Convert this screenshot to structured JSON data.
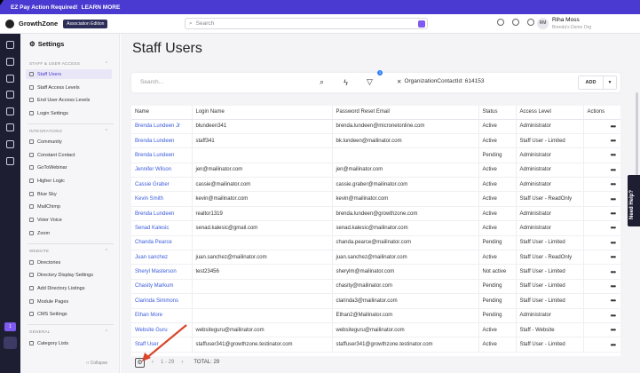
{
  "alert": {
    "text": "EZ Pay Action Required!",
    "link": "LEARN MORE"
  },
  "header": {
    "brand": "GrowthZone",
    "edition": "Association Edition",
    "search_placeholder": "Search",
    "user_initials": "RM",
    "user_name": "Riha Moss",
    "user_org": "Brenda's Demo Org"
  },
  "sidebar": {
    "title": "Settings",
    "sections": [
      {
        "label": "STAFF & USER ACCESS",
        "items": [
          "Staff Users",
          "Staff Access Levels",
          "End User Access Levels",
          "Login Settings"
        ]
      },
      {
        "label": "INTEGRATIONS",
        "items": [
          "Community",
          "Constant Contact",
          "GoToWebinar",
          "Higher Logic",
          "Blue Sky",
          "MailChimp",
          "Voter Voice",
          "Zoom"
        ]
      },
      {
        "label": "WEBSITE",
        "items": [
          "Directories",
          "Directory Display Settings",
          "Add Directory Listings",
          "Module Pages",
          "CMS Settings"
        ]
      },
      {
        "label": "GENERAL",
        "items": [
          "Category Lists"
        ]
      }
    ],
    "collapse_label": "Collapse",
    "notification_count": "1"
  },
  "main": {
    "title": "Staff Users",
    "search_placeholder": "Search...",
    "filter_chip": "OrganizationContactId: 614153",
    "filter_badge": "1",
    "add_label": "ADD",
    "columns": [
      "Name",
      "Login Name",
      "Password Reset Email",
      "Status",
      "Access Level",
      "Actions"
    ],
    "rows": [
      [
        "Brenda Lundeen Jr",
        "blundeen341",
        "brenda.lundeen@micronetonline.com",
        "Active",
        "Administrator"
      ],
      [
        "Brenda Lundeen",
        "staff341",
        "bk.lundeen@mailinator.com",
        "Active",
        "Staff User - Limited"
      ],
      [
        "Brenda Lundeen",
        "",
        "",
        "Pending",
        "Administrator"
      ],
      [
        "Jennifer Wilson",
        "jen@mailinator.com",
        "jen@mailinator.com",
        "Active",
        "Administrator"
      ],
      [
        "Cassie Graber",
        "cassie@mailinator.com",
        "cassie.graber@mailinator.com",
        "Active",
        "Administrator"
      ],
      [
        "Kevin Smith",
        "kevin@mailinator.com",
        "kevin@mailinator.com",
        "Active",
        "Staff User - ReadOnly"
      ],
      [
        "Brenda Lundeen",
        "realtor1319",
        "brenda.lundeen@growthzone.com",
        "Active",
        "Administrator"
      ],
      [
        "Senad Kalesic",
        "senad.kalesic@gmail.com",
        "senad.kalesic@mailinator.com",
        "Active",
        "Administrator"
      ],
      [
        "Chanda Pearce",
        "",
        "chanda.pearce@mailinator.com",
        "Pending",
        "Staff User - Limited"
      ],
      [
        "Juan sanchez",
        "juan.sanchez@mailinator.com",
        "juan.sanchez@mailinator.com",
        "Active",
        "Staff User - ReadOnly"
      ],
      [
        "Sheryl Masterson",
        "test23456",
        "sherylm@mailinator.com",
        "Not active",
        "Staff User - Limited"
      ],
      [
        "Chasity Markum",
        "",
        "chasity@mailinator.com",
        "Pending",
        "Staff User - Limited"
      ],
      [
        "Clarinda Simmons",
        "",
        "clarinda3@mailinator.com",
        "Pending",
        "Staff User - Limited"
      ],
      [
        "Ethan More",
        "",
        "Ethan2@Mailinator.com",
        "Pending",
        "Administrator"
      ],
      [
        "Website Guru",
        "websiteguru@mailinator.com",
        "websiteguru@mailinator.com",
        "Active",
        "Staff - Website"
      ],
      [
        "Staff User",
        "staffuser341@growthzone.testinator.com",
        "staffuser341@growthzone.testinator.com",
        "Active",
        "Staff User - Limited"
      ]
    ],
    "actions_glyph": "•••",
    "pagination": "1 - 29",
    "total": "TOTAL: 29"
  },
  "need_help": "Need Help?",
  "colors": {
    "accent": "#4a3ad1",
    "link": "#3b5bdb",
    "rail": "#1e1e33",
    "arrow": "#d9452b"
  }
}
